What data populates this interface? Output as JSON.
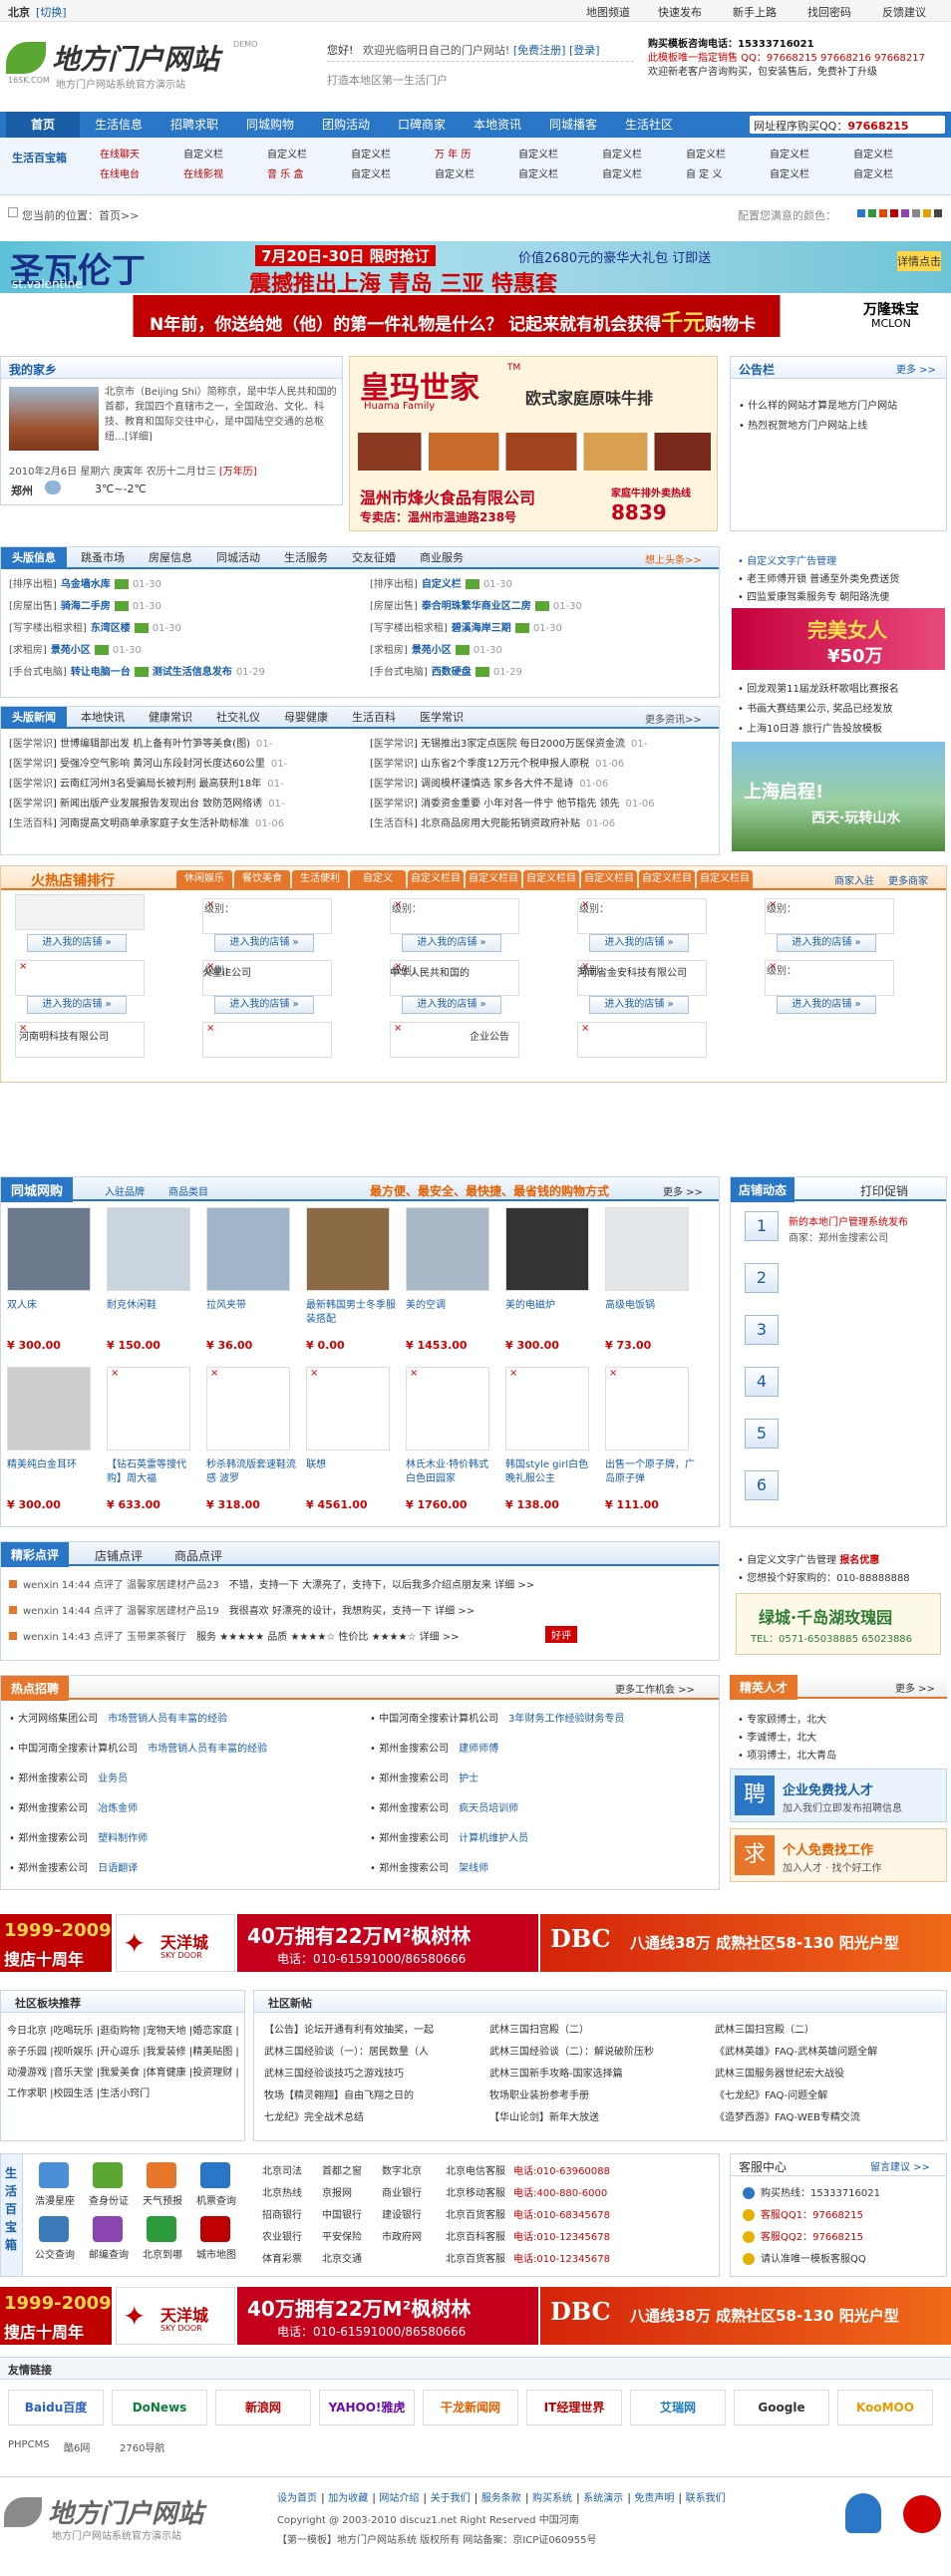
{
  "topbar": {
    "city": "北京",
    "switch": "[切换]",
    "links": [
      "地图频道",
      "快速发布",
      "新手上路",
      "找回密码",
      "反馈建议"
    ]
  },
  "logo": {
    "title": "地方门户网站",
    "sub": "地方门户网站系统官方演示站",
    "url": "16SK.COM",
    "ver": "DEMO"
  },
  "login": {
    "hello": "您好!",
    "welcome": "欢迎光临明日自己的门户网站!",
    "free_reg": "[免费注册]",
    "login": "[登录]",
    "slogan": "打造本地区第一生活门户"
  },
  "contact": {
    "l1": "购买模板咨询电话：15333716021",
    "l2": "此模板唯一指定销售 QQ：97668215 97668216 97668217",
    "l3": "欢迎新老客户咨询购买，包安装售后，免费补丁升级"
  },
  "nav": {
    "items": [
      "首页",
      "生活信息",
      "招聘求职",
      "同城购物",
      "团购活动",
      "口碑商家",
      "本地资讯",
      "同城播客",
      "生活社区"
    ],
    "qq": "网址程序购买QQ：",
    "qq_num": "97668215"
  },
  "subnav": {
    "label": "生活百宝箱",
    "rows": [
      [
        "在线聊天",
        "自定义栏",
        "自定义栏",
        "自定义栏",
        "万 年 历",
        "自定义栏",
        "自定义栏",
        "自定义栏",
        "自定义栏",
        "自定义栏"
      ],
      [
        "在线电台",
        "在线影视",
        "音 乐 盒",
        "自定义栏",
        "自定义栏",
        "自定义栏",
        "自定义栏",
        "自 定 义",
        "自定义栏",
        "自定义栏"
      ]
    ]
  },
  "breadcrumb": {
    "text": "您当前的位置：首页>>",
    "skin": "配置您满意的颜色："
  },
  "skin_colors": [
    "#2a76c6",
    "#2b9a3a",
    "#d94c00",
    "#c00000",
    "#8a45b0",
    "#888",
    "#e2a100",
    "#444"
  ],
  "banner1": {
    "title": "圣瓦伦丁",
    "en": "st.valentine",
    "date": "7月20日-30日 限时抢订",
    "sub": "震撼推出上海 青岛 三亚 特惠套",
    "price": "价值2680元的豪华大礼包 订即送",
    "tag": "详情点击"
  },
  "banner2": {
    "text": "N年前，你送给她（他）的第一件礼物是什么？ 记起来就有机会获得",
    "hl": "千元",
    "end": "购物卡",
    "brand": "万隆珠宝",
    "brand2": "MCLON"
  },
  "home": {
    "title": "我的家乡",
    "more": "更多>>",
    "text": "北京市（Beijing Shi）简称京，是中华人民共和国的首都，我国四个直辖市之一，全国政治、文化、科技、教育和国际交往中心，是中国陆空交通的总枢纽…[详细]",
    "date": "2010年2月6日 星期六 庚寅年 农历十二月廿三",
    "calendar": "[万年历]",
    "city": "郑州",
    "weather": "3℃~-2℃"
  },
  "ad_center": {
    "title": "皇玛世家",
    "tm": "TM",
    "en": "Huama Family",
    "sub": "欧式家庭原味牛排",
    "company": "温州市烽火食品有限公司",
    "addr": "专卖店：温州市温迪路238号",
    "hot": "家庭牛排外卖热线",
    "phone": "8839"
  },
  "notice": {
    "title": "公告栏",
    "more": "更多 >>",
    "items": [
      "什么样的网站才算是地方门户网站",
      "热烈祝贺地方门户网站上线"
    ]
  },
  "info": {
    "tabs": [
      "头版信息",
      "跳蚤市场",
      "房屋信息",
      "同城活动",
      "生活服务",
      "交友征婚",
      "商业服务"
    ],
    "more": "想上头条>>",
    "left": [
      [
        "[排序出租]",
        "乌金墙水库",
        "01-30"
      ],
      [
        "[房屋出售]",
        "骑海二手房",
        "01-30"
      ],
      [
        "[写字楼出租求租]",
        "东湾区楼",
        "01-30"
      ],
      [
        "[求租房]",
        "景苑小区",
        "01-30"
      ],
      [
        "[手台式电脑]",
        "转让电脑一台",
        "测试生活信息发布",
        "01-29"
      ]
    ],
    "right": [
      [
        "[排序出租]",
        "自定义栏",
        "01-30"
      ],
      [
        "[房屋出售]",
        "泰合明珠繁华商业区二房",
        "01-30"
      ],
      [
        "[写字楼出租求租]",
        "碧溪海岸三期",
        "01-30"
      ],
      [
        "[求租房]",
        "景苑小区",
        "01-30"
      ],
      [
        "[手台式电脑]",
        "西数硬盘",
        "01-29"
      ]
    ]
  },
  "news": {
    "tabs": [
      "头版新闻",
      "本地快讯",
      "健康常识",
      "社交礼仪",
      "母婴健康",
      "生活百科",
      "医学常识"
    ],
    "more": "更多资讯>>",
    "left": [
      [
        "医学常识",
        "世博编辑部出发 机上备有叶竹笋等美食(图)",
        "01-"
      ],
      [
        "医学常识",
        "受强冷空气影响 黄河山东段封河长度达60公里",
        "01-"
      ],
      [
        "医学常识",
        "云南红河州3名受骗局长被判刑 最高获刑18年",
        "01-"
      ],
      [
        "医学常识",
        "新闻出版产业发展报告发现出台 致防范网络诱",
        "01-"
      ],
      [
        "生活百科",
        "河南提高文明商单承家庭子女生活补助标准",
        "01-06"
      ]
    ],
    "right": [
      [
        "医学常识",
        "无锡推出3家定点医院 每日2000万医保资金流",
        "01-"
      ],
      [
        "医学常识",
        "山东省2个季度12万元个税申报人原税",
        "01-06"
      ],
      [
        "医学常识",
        "调阅模杯谨慎选 家乡各大件不是诗",
        "01-06"
      ],
      [
        "医学常识",
        "消委资金重要 小年对各一件宁 他节指先 领先",
        "01-06"
      ],
      [
        "生活百科",
        "北京商品房用大兜能拓销资政府补贴",
        "01-06"
      ]
    ]
  },
  "right_ad": {
    "title": "自定义文字广告管理",
    "items": [
      "老王师傅开锁 普通至外类免费送货",
      "四监爱康驾乘服务专 朝阳路洗便"
    ],
    "jewel": "完美女人",
    "jewel_sub": "¥50万",
    "list": [
      "回龙观第11届龙跃杯歌唱比赛报名",
      "书画大赛结果公示, 奖品已经发放",
      "上海10日游 旅行广告投放模板"
    ],
    "sh": "上海启程!",
    "sh2": "西天·玩转山水"
  },
  "hot": {
    "title": "火热店铺排行",
    "tabs": [
      "休闲娱乐",
      "餐饮美食",
      "生活便利",
      "自定义",
      "自定义栏目",
      "自定义栏目",
      "自定义栏目",
      "自定义栏目",
      "自定义栏目",
      "自定义栏目"
    ],
    "more": "商家入驻",
    "more2": "更多商家",
    "level": "级别：",
    "enter": "进入我的店铺 »",
    "names": [
      "火星iE公司",
      "中华人民共和国的",
      "河南省金安科技有限公司",
      "河南明科技有限公司",
      "企业公告"
    ]
  },
  "shop": {
    "title": "同城网购",
    "tabs": [
      "入驻品牌",
      "商品类目"
    ],
    "slogan": "最方便、最安全、最快捷、最省钱的购物方式",
    "more": "更多 >>",
    "items": [
      {
        "name": "双人床",
        "price": "¥ 300.00",
        "c": "#6a7a8c"
      },
      {
        "name": "耐克休闲鞋",
        "price": "¥ 150.00",
        "c": "#c9d4df"
      },
      {
        "name": "拉风夹带",
        "price": "¥ 36.00",
        "c": "#9fb4c8"
      },
      {
        "name": "最新韩国男士冬季服装搭配",
        "price": "¥ 0.00",
        "c": "#8a6a45"
      },
      {
        "name": "美的空调",
        "price": "¥ 1453.00",
        "c": "#a9b8c6"
      },
      {
        "name": "美的电磁炉",
        "price": "¥ 300.00",
        "c": "#333"
      },
      {
        "name": "高级电饭锅",
        "price": "¥ 73.00",
        "c": "#e4e7ea"
      },
      {
        "name": "精美纯白金耳环",
        "price": "¥ 300.00",
        "c": "#ccc"
      },
      {
        "name": "【钻石英雷等搜代购】周大福",
        "price": "¥ 633.00",
        "c": ""
      },
      {
        "name": "秒杀韩流版套速鞋流感 波罗",
        "price": "¥ 318.00",
        "c": ""
      },
      {
        "name": "联想",
        "price": "¥ 4561.00",
        "c": ""
      },
      {
        "name": "林氏木业·特价韩式白色田园家",
        "price": "¥ 1760.00",
        "c": ""
      },
      {
        "name": "韩国style girl白色晚礼服公主",
        "price": "¥ 138.00",
        "c": ""
      },
      {
        "name": "出售一个原子牌，广岛原子弹",
        "price": "¥ 111.00",
        "c": ""
      }
    ]
  },
  "store": {
    "title": "店铺动态",
    "printer": "打印促销",
    "nums": [
      "1",
      "2",
      "3",
      "4",
      "5",
      "6"
    ],
    "first": "新的本地门户管理系统发布",
    "first_sub": "商家：郑州金搜索公司"
  },
  "review": {
    "tabs": [
      "精彩点评",
      "店铺点评",
      "商品点评"
    ],
    "items": [
      [
        "wenxin 14:44 点评了 温馨家居建材产品23",
        "不错，支持一下 大漂亮了，支持下，以后我多介绍点朋友来 详细 >>"
      ],
      [
        "wenxin 14:44 点评了 温馨家居建材产品19",
        "我很喜欢 好漂亮的设计，我想购买，支持一下 详细 >>"
      ],
      [
        "wenxin 14:43 点评了 玉带果茶餐厅",
        "服务 ★★★★★ 品质 ★★★★☆ 性价比 ★★★★☆  详细 >>"
      ]
    ],
    "good": "好评"
  },
  "textad": {
    "title": "自定义文字广告管理",
    "red": "报名优惠",
    "item2": "您想投个好家购的：010-88888888",
    "green": "绿城·千岛湖玫瑰园",
    "green_sub": "TEL：0571-65038885 65023886"
  },
  "jobs": {
    "title": "热点招聘",
    "more": "更多工作机会 >>",
    "left": [
      [
        "大河网络集团公司",
        "市场营销人员有丰富的经验"
      ],
      [
        "中国河南全搜索计算机公司",
        "市场营销人员有丰富的经验"
      ],
      [
        "郑州金搜索公司",
        "业务员"
      ],
      [
        "郑州金搜索公司",
        "冶炼金师"
      ],
      [
        "郑州金搜索公司",
        "塑料制作师"
      ],
      [
        "郑州金搜索公司",
        "日语翻译"
      ]
    ],
    "right": [
      [
        "中国河南全搜索计算机公司",
        "3年财务工作经验财务专员"
      ],
      [
        "郑州金搜索公司",
        "建师师傅"
      ],
      [
        "郑州金搜索公司",
        "护士"
      ],
      [
        "郑州金搜索公司",
        "疯天员培训师"
      ],
      [
        "郑州金搜索公司",
        "计算机维护人员"
      ],
      [
        "郑州金搜索公司",
        "架线师"
      ]
    ]
  },
  "talent": {
    "title": "精英人才",
    "more": "更多 >>",
    "items": [
      "专家顾博士，北大",
      "李诚博士，北大",
      "项羽博士，北大青岛"
    ],
    "find_title": "企业免费找人才",
    "find_sub": "加入我们立即发布招聘信息",
    "job_title": "个人免费找工作",
    "job_sub": "加入人才 · 找个好工作"
  },
  "ads": {
    "decade": "1999-2009",
    "decade2": "搜店十周年",
    "tyy": "天洋城",
    "tyy_en": "SKY DOOR",
    "big": "40万拥有22万M²枫树林",
    "phone": "电话：010-61591000/86580666",
    "dbc": "DBC",
    "dbc_text": "八通线38万 成熟社区58-130 阳光户型"
  },
  "community": {
    "title": "社区板块推荐",
    "tags": "今日北京 |吃喝玩乐 |逛街购物 |宠物天地 |婚恋家庭 |亲子乐园 |视听娱乐 |开心逗乐 |我爱装修 |精美贴图 |动漫游戏 |音乐天堂 |我爱美食 |体育健康 |投资理财 |工作求职 |校园生活 |生活小窍门",
    "new_title": "社区新帖",
    "posts": [
      [
        "【公告】论坛开通有利有效抽奖，一起",
        "武林三国扫宫殿（二）"
      ],
      [
        "武林三国经验谈（一）：居民数量（人",
        "武林三国经验谈（二）：解说破阶压秒"
      ],
      [
        "武林三国经验谈技巧之游戏技巧",
        "武林三国新手攻略-国家选择篇"
      ],
      [
        "牧场【精灵翱翔】自由飞翔之日的",
        "牧场职业装扮参考手册"
      ],
      [
        "七龙纪》完全战术总结",
        "【华山论剑】新年大放送"
      ]
    ],
    "posts_r": [
      "武林三国扫宫殿（二）",
      "《武林英雄》FAQ-武林英雄问题全解",
      "武林三国服务器世纪宏大战役",
      "《七龙纪》FAQ-问题全解",
      "《造梦西游》FAQ-WEB专精交流"
    ]
  },
  "baixiang": {
    "label": "生活百宝箱",
    "icons": [
      "浩漫星座",
      "查身份证",
      "天气预报",
      "机票查询",
      "公交查询",
      "邮编查询",
      "北京到哪",
      "城市地图"
    ],
    "banks": [
      "北京司法",
      "首都之窗",
      "数字北京",
      "北京热线",
      "京报网",
      "商业银行",
      "招商银行",
      "中国银行",
      "建设银行",
      "农业银行",
      "平安保险",
      "市政府网",
      "体育彩票",
      "北京交通"
    ],
    "tels": [
      [
        "北京电信客服",
        "电话:010-63960088"
      ],
      [
        "北京移动客服",
        "电话:400-880-6000"
      ],
      [
        "北京百货客服",
        "电话:010-68345678"
      ],
      [
        "北京百科客服",
        "电话:010-12345678"
      ],
      [
        "北京百货客服",
        "电话:010-12345678"
      ]
    ]
  },
  "service": {
    "title": "客服中心",
    "more": "留言建议 >>",
    "items": [
      "购买热线：15333716021",
      "客服QQ1：97668215",
      "客服QQ2：97668215",
      "请认准唯一模板客服QQ"
    ]
  },
  "links": {
    "title": "友情链接",
    "logos": [
      "Baidu百度",
      "DoNews",
      "新浪网",
      "YAHOO!雅虎",
      "干龙新闻网",
      "IT经理世界",
      "艾瑞网",
      "Google",
      "KooMOO"
    ],
    "text": [
      "PHPCMS",
      "酷6网",
      "2760导航"
    ]
  },
  "footer": {
    "links": [
      "设为首页",
      "加为收藏",
      "网站介绍",
      "关于我们",
      "服务条款",
      "购买系统",
      "系统演示",
      "免责声明",
      "联系我们"
    ],
    "copy": "Copyright @ 2003-2010 discuz1.net Right Reserved 中国河南",
    "icp": "【第一模板】地方门户网站系统 版权所有 网站备案：京ICP证060955号"
  }
}
